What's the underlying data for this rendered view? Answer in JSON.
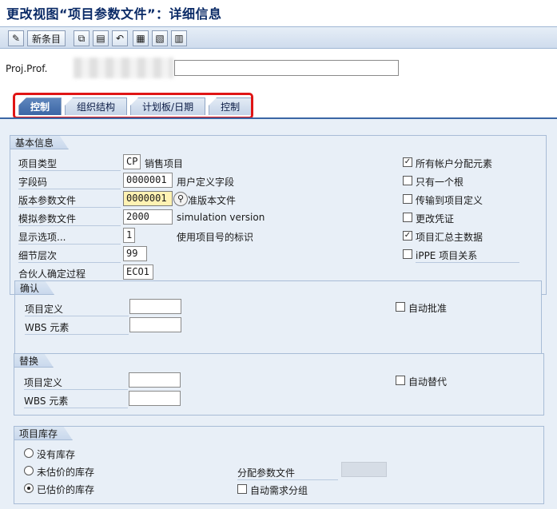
{
  "title": "更改视图“项目参数文件”：详细信息",
  "toolbar": {
    "new_entry_label": "新条目"
  },
  "proj": {
    "label": "Proj.Prof."
  },
  "tabs": [
    "控制",
    "组织结构",
    "计划板/日期",
    "控制"
  ],
  "basic": {
    "title": "基本信息",
    "rows": [
      {
        "label": "项目类型",
        "value": "CP",
        "desc": "销售项目"
      },
      {
        "label": "字段码",
        "value": "0000001",
        "desc": "用户定义字段"
      },
      {
        "label": "版本参数文件",
        "value": "0000001",
        "desc": "准版本文件"
      },
      {
        "label": "模拟参数文件",
        "value": "2000",
        "desc": "simulation version"
      },
      {
        "label": "显示选项...",
        "value": "1",
        "desc": "使用项目号的标识"
      },
      {
        "label": "细节层次",
        "value": "99",
        "desc": ""
      },
      {
        "label": "合伙人确定过程",
        "value": "ECO1",
        "desc": ""
      }
    ],
    "checks": [
      {
        "label": "所有帐户分配元素",
        "checked": true
      },
      {
        "label": "只有一个根",
        "checked": false
      },
      {
        "label": "传输到项目定义",
        "checked": false
      },
      {
        "label": "更改凭证",
        "checked": false
      },
      {
        "label": "项目汇总主数据",
        "checked": true
      },
      {
        "label": "iPPE 项目关系",
        "checked": false
      }
    ]
  },
  "confirm": {
    "title": "确认",
    "proj_def": "项目定义",
    "wbs": "WBS 元素",
    "auto": "自动批准"
  },
  "subst": {
    "title": "替换",
    "proj_def": "项目定义",
    "wbs": "WBS 元素",
    "auto": "自动替代"
  },
  "stock": {
    "title": "项目库存",
    "options": [
      {
        "label": "没有库存",
        "selected": false
      },
      {
        "label": "未估价的库存",
        "selected": false
      },
      {
        "label": "已估价的库存",
        "selected": true
      }
    ],
    "alloc_label": "分配参数文件",
    "auto_req": "自动需求分组"
  },
  "colors": {
    "accent": "#3b66a5",
    "highlight": "#e01515",
    "panel": "#e8eff7"
  }
}
